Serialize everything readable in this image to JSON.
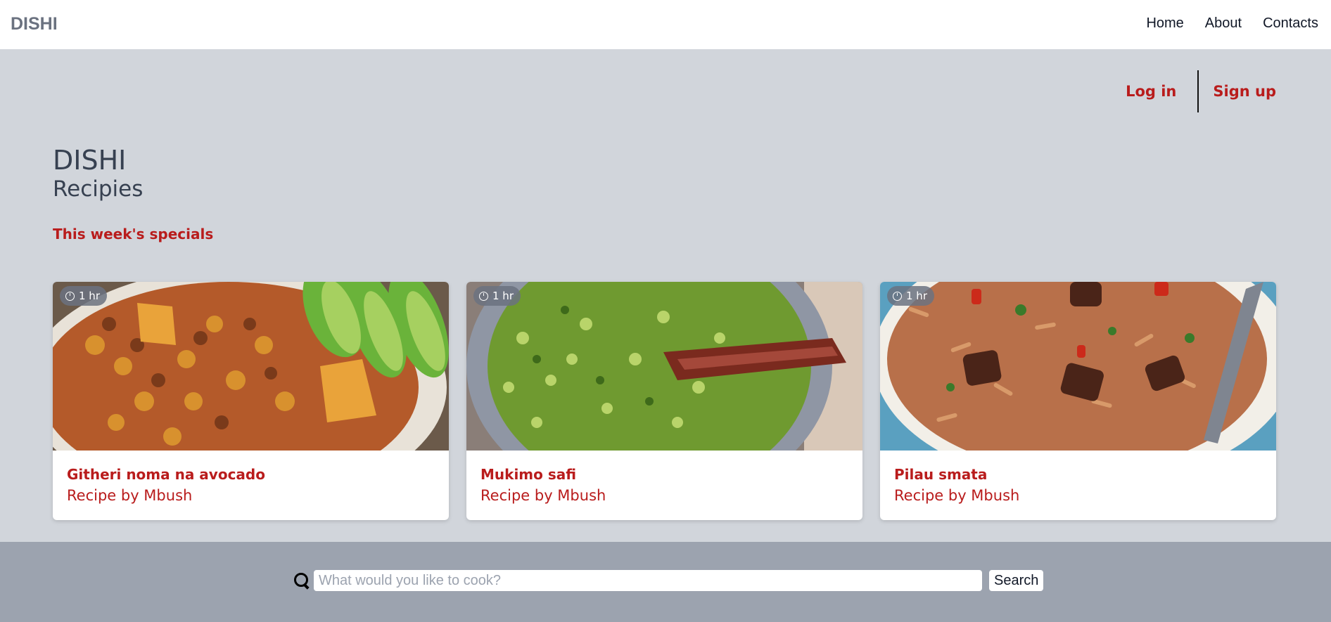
{
  "nav": {
    "brand": "DISHI",
    "links": [
      "Home",
      "About",
      "Contacts"
    ]
  },
  "auth": {
    "login": "Log in",
    "signup": "Sign up"
  },
  "hero": {
    "title": "DISHI",
    "subtitle": "Recipies",
    "specials_heading": "This week's specials"
  },
  "cards": [
    {
      "time": "1 hr",
      "title": "Githeri noma na avocado",
      "author": "Recipe by Mbush",
      "image": "githeri-photo"
    },
    {
      "time": "1 hr",
      "title": "Mukimo safi",
      "author": "Recipe by Mbush",
      "image": "mukimo-photo"
    },
    {
      "time": "1 hr",
      "title": "Pilau smata",
      "author": "Recipe by Mbush",
      "image": "pilau-photo"
    }
  ],
  "search": {
    "placeholder": "What would you like to cook?",
    "button": "Search",
    "icon": "search-icon"
  },
  "colors": {
    "accent": "#b91c1c",
    "hero_bg": "#d1d5db",
    "footer_bg": "#9ca3af",
    "brand": "#6b7280"
  }
}
